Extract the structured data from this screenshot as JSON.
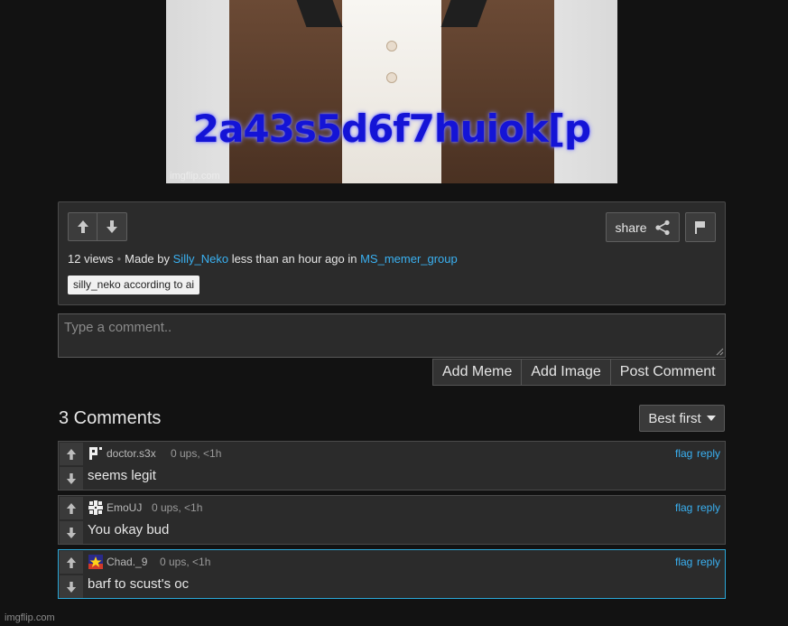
{
  "meme": {
    "caption": "2a43s5d6f7huiok[p",
    "watermark": "imgflip.com"
  },
  "post": {
    "views": "12 views",
    "made_by_prefix": "Made by",
    "author": "Silly_Neko",
    "time_text": "less than an hour ago in",
    "group": "MS_memer_group",
    "tag": "silly_neko according to ai",
    "share_label": "share"
  },
  "comment_form": {
    "placeholder": "Type a comment..",
    "add_meme": "Add Meme",
    "add_image": "Add Image",
    "post_comment": "Post Comment"
  },
  "comments_header": {
    "count_label": "3 Comments",
    "sort_label": "Best first"
  },
  "comments": [
    {
      "user": "doctor.s3x",
      "stats": "0 ups, <1h",
      "text": "seems legit",
      "flag": "flag",
      "reply": "reply"
    },
    {
      "user": "EmoUJ",
      "stats": "0 ups, <1h",
      "text": "You okay bud",
      "flag": "flag",
      "reply": "reply"
    },
    {
      "user": "Chad._9",
      "stats": "0 ups, <1h",
      "text": "barf to scust's oc",
      "flag": "flag",
      "reply": "reply"
    }
  ],
  "footer": {
    "watermark": "imgflip.com"
  },
  "colors": {
    "accent_link": "#3ab1f2",
    "highlight_border": "#2aa7d8",
    "caption_blue": "#1414d6"
  }
}
